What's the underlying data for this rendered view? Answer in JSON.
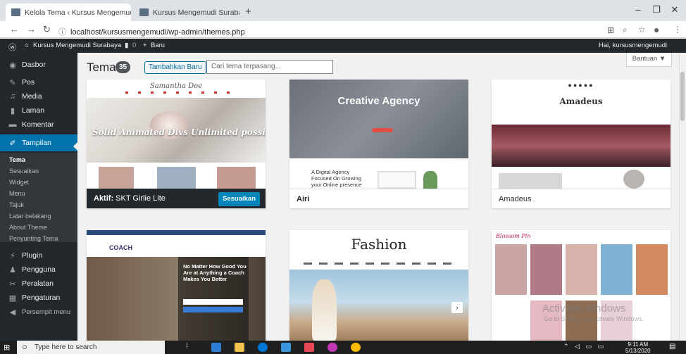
{
  "browser": {
    "tabs": [
      {
        "title": "Kelola Tema ‹ Kursus Mengemudi"
      },
      {
        "title": "Kursus Mengemudi Surabaya"
      }
    ],
    "url": "localhost/kursusmengemudi/wp-admin/themes.php"
  },
  "adminbar": {
    "site_name": "Kursus Mengemudi Surabaya",
    "comments": "0",
    "new_label": "Baru",
    "greeting": "Hai, kursusmengemudi"
  },
  "sidebar": {
    "items": [
      {
        "label": "Dasbor",
        "icon": "dashboard-icon"
      },
      {
        "label": "Pos",
        "icon": "pin-icon"
      },
      {
        "label": "Media",
        "icon": "media-icon"
      },
      {
        "label": "Laman",
        "icon": "page-icon"
      },
      {
        "label": "Komentar",
        "icon": "comment-icon"
      },
      {
        "label": "Tampilan",
        "icon": "brush-icon"
      }
    ],
    "submenu": [
      "Tema",
      "Sesuaikan",
      "Widget",
      "Menu",
      "Tajuk",
      "Latar belakang",
      "About Theme",
      "Penyunting Tema"
    ],
    "items2": [
      {
        "label": "Plugin",
        "icon": "plugin-icon"
      },
      {
        "label": "Pengguna",
        "icon": "user-icon"
      },
      {
        "label": "Peralatan",
        "icon": "wrench-icon"
      },
      {
        "label": "Pengaturan",
        "icon": "settings-icon"
      },
      {
        "label": "Persempit menu",
        "icon": "collapse-icon"
      }
    ]
  },
  "header": {
    "title": "Tema",
    "count": "35",
    "add_new": "Tambahkan Baru",
    "search_placeholder": "Cari tema terpasang...",
    "help": "Bantuan ▼"
  },
  "themes": {
    "active": {
      "prefix": "Aktif:",
      "name": "SKT Girlie Lite",
      "customize": "Sesuaikan",
      "shot_title": "Samantha Doe",
      "shot_tagline": "Solid Animated Divs Unlimited possibilities"
    },
    "airi": {
      "name": "Airi",
      "shot_title": "Creative Agency",
      "shot_tag": "A Digital Agency Focused On Growing your Online presence"
    },
    "amadeus": {
      "name": "Amadeus",
      "shot_title": "Amadeus"
    },
    "coach": {
      "shot_title": "COACH",
      "shot_tag": "No Matter How Good You Are at Anything a Coach Makes You Better"
    },
    "fashion": {
      "shot_title": "Fashion"
    },
    "blossom": {
      "shot_title": "Blossom Pin"
    }
  },
  "watermark": {
    "line1": "Activate Windows",
    "line2": "Go to Settings to activate Windows."
  },
  "taskbar": {
    "search": "Type here to search",
    "time": "9:11 AM",
    "date": "5/13/2020"
  }
}
